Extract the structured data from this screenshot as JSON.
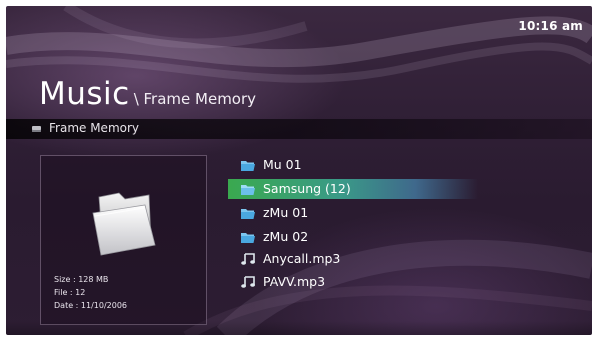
{
  "clock": "10:16 am",
  "title": {
    "main": "Music",
    "path": "\\ Frame Memory"
  },
  "pathbar": {
    "icon": "memory-card-icon",
    "label": "Frame Memory"
  },
  "info": {
    "icon": "folder-icon",
    "size": "Size : 128 MB",
    "file": "File : 12",
    "date": "Date : 11/10/2006"
  },
  "items": [
    {
      "label": "Mu 01",
      "icon": "folder-icon",
      "selected": false
    },
    {
      "label": "Samsung (12)",
      "icon": "folder-icon",
      "selected": true
    },
    {
      "label": "zMu 01",
      "icon": "folder-icon",
      "selected": false
    },
    {
      "label": "zMu 02",
      "icon": "folder-icon",
      "selected": false
    },
    {
      "label": "Anycall.mp3",
      "icon": "music-note-icon",
      "selected": false
    },
    {
      "label": "PAVV.mp3",
      "icon": "music-note-icon",
      "selected": false
    }
  ],
  "colors": {
    "background": "#2f1f35",
    "selection": "#3aa94f",
    "folder_icon": "#5fb6e8",
    "text": "#ffffff"
  }
}
